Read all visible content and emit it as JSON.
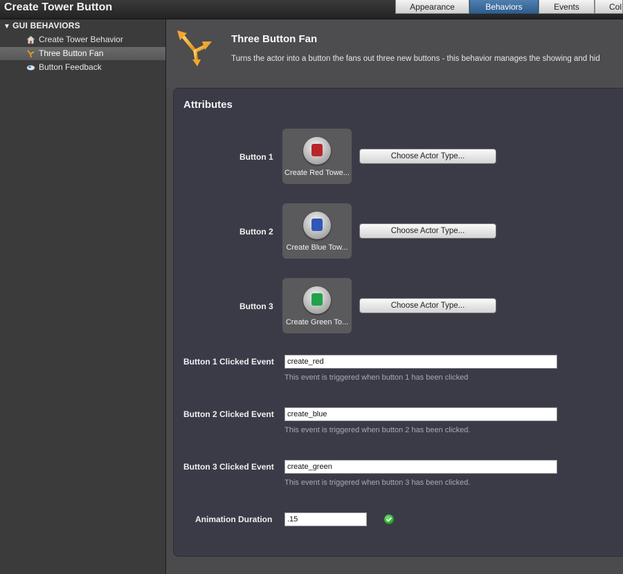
{
  "window": {
    "title": "Create Tower Button"
  },
  "tabs": [
    {
      "label": "Appearance",
      "active": false
    },
    {
      "label": "Behaviors",
      "active": true
    },
    {
      "label": "Events",
      "active": false
    },
    {
      "label": "Col",
      "active": false
    }
  ],
  "sidebar": {
    "group_label": "GUI BEHAVIORS",
    "items": [
      {
        "label": "Create Tower Behavior",
        "icon": "house-icon",
        "selected": false
      },
      {
        "label": "Three Button Fan",
        "icon": "fan-arrows-icon",
        "selected": true
      },
      {
        "label": "Button Feedback",
        "icon": "button-feedback-icon",
        "selected": false
      }
    ]
  },
  "behavior": {
    "title": "Three Button Fan",
    "description": "Turns the actor into a button the fans out three new buttons - this behavior manages the showing and hid"
  },
  "attributes": {
    "title": "Attributes",
    "buttons": [
      {
        "label": "Button 1",
        "actor_name": "Create Red Towe...",
        "actor_color": "#b8262a",
        "choose_label": "Choose Actor Type..."
      },
      {
        "label": "Button 2",
        "actor_name": "Create Blue Tow...",
        "actor_color": "#2f56b8",
        "choose_label": "Choose Actor Type..."
      },
      {
        "label": "Button 3",
        "actor_name": "Create Green To...",
        "actor_color": "#23a24a",
        "choose_label": "Choose Actor Type..."
      }
    ],
    "events": [
      {
        "label": "Button 1 Clicked Event",
        "value": "create_red",
        "help": "This event is triggered when button 1 has been clicked"
      },
      {
        "label": "Button 2 Clicked Event",
        "value": "create_blue",
        "help": "This event is triggered when button 2 has been clicked."
      },
      {
        "label": "Button 3 Clicked Event",
        "value": "create_green",
        "help": "This event is triggered when button 3 has been clicked."
      }
    ],
    "duration": {
      "label": "Animation Duration",
      "value": ".15",
      "valid": true
    }
  },
  "colors": {
    "active_tab": "#3a6a9c",
    "selected_item": "#606060",
    "panel_bg": "#3b3b48",
    "valid": "#1f9b1f"
  }
}
